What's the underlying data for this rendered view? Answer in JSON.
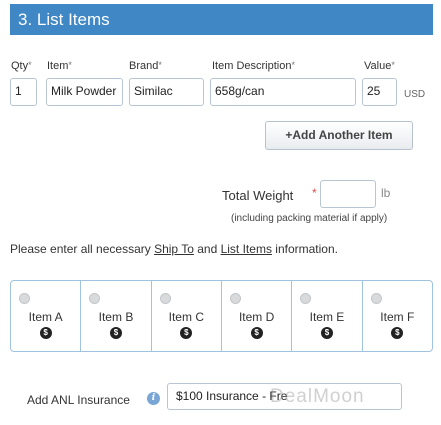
{
  "section": {
    "title": "3. List Items"
  },
  "columns": {
    "qty": "Qty",
    "item": "Item",
    "brand": "Brand",
    "description": "Item Description",
    "value": "Value",
    "required_mark": "*"
  },
  "row": {
    "qty": "1",
    "item": "Milk Powder",
    "brand": "Similac",
    "description": "658g/can",
    "value": "25",
    "currency": "USD"
  },
  "add_button": {
    "label": "+Add Another Item"
  },
  "total_weight": {
    "label": "Total Weight",
    "required_mark": "*",
    "value": "",
    "unit": "lb",
    "note": "(including packing material if apply)"
  },
  "notice": {
    "prefix": "Please enter all necessary ",
    "link1": "Ship To",
    "middle": " and ",
    "link2": "List Items",
    "suffix": " information."
  },
  "items": [
    {
      "label": "Item A",
      "icon": "$"
    },
    {
      "label": "Item B",
      "icon": "$"
    },
    {
      "label": "Item C",
      "icon": "$"
    },
    {
      "label": "Item D",
      "icon": "$"
    },
    {
      "label": "Item E",
      "icon": "$"
    },
    {
      "label": "Item F",
      "icon": "$"
    }
  ],
  "insurance": {
    "label": "Add ANL Insurance",
    "info_icon": "i",
    "selected": "$100 Insurance - Fre"
  },
  "watermark": "DealMoon"
}
